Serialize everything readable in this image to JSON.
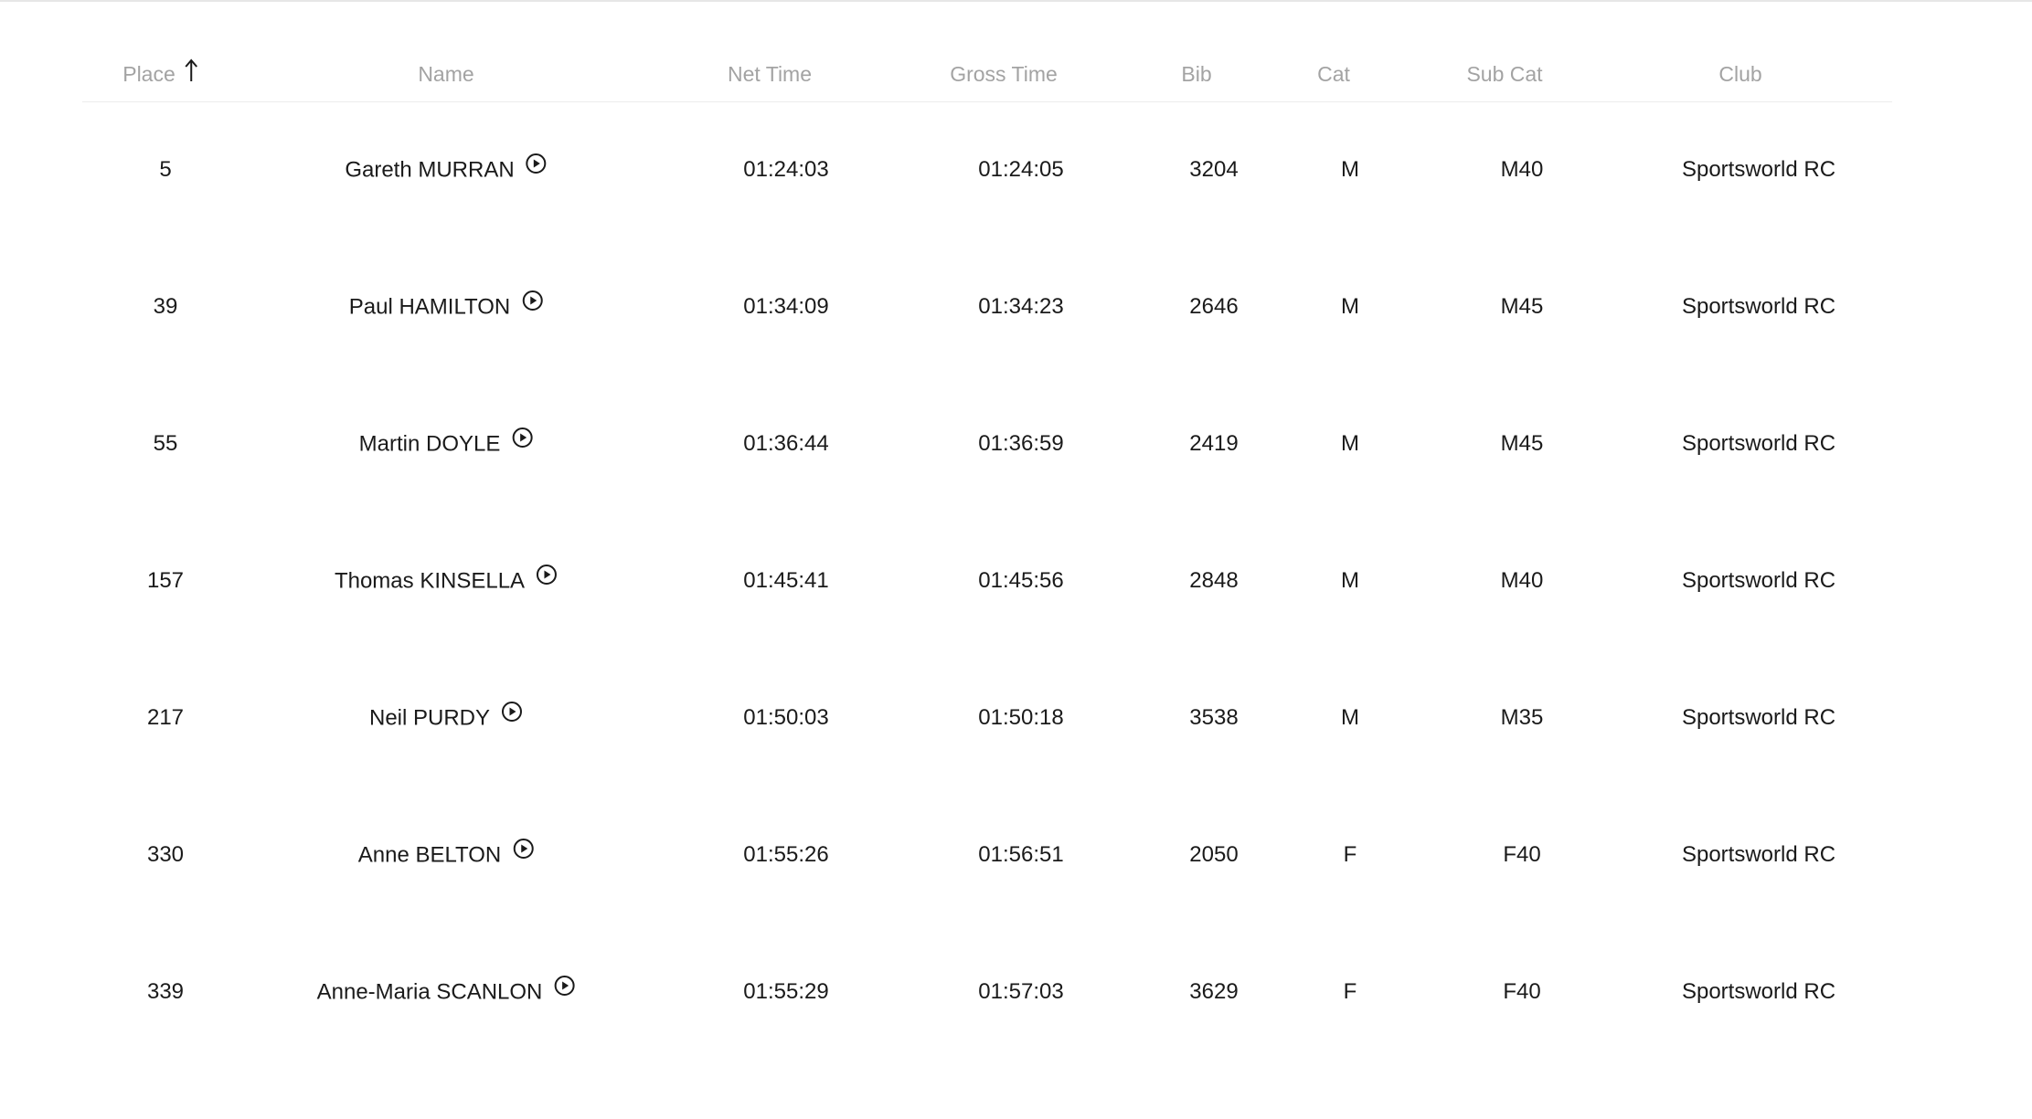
{
  "table": {
    "columns": {
      "place": "Place",
      "name": "Name",
      "net_time": "Net Time",
      "gross_time": "Gross Time",
      "bib": "Bib",
      "cat": "Cat",
      "sub_cat": "Sub Cat",
      "club": "Club"
    },
    "sort": {
      "column": "place",
      "direction": "ascending",
      "icon": "arrow-up-icon"
    },
    "rows": [
      {
        "place": "5",
        "name": "Gareth MURRAN",
        "net_time": "01:24:03",
        "gross_time": "01:24:05",
        "bib": "3204",
        "cat": "M",
        "sub_cat": "M40",
        "club": "Sportsworld RC"
      },
      {
        "place": "39",
        "name": "Paul HAMILTON",
        "net_time": "01:34:09",
        "gross_time": "01:34:23",
        "bib": "2646",
        "cat": "M",
        "sub_cat": "M45",
        "club": "Sportsworld RC"
      },
      {
        "place": "55",
        "name": "Martin DOYLE",
        "net_time": "01:36:44",
        "gross_time": "01:36:59",
        "bib": "2419",
        "cat": "M",
        "sub_cat": "M45",
        "club": "Sportsworld RC"
      },
      {
        "place": "157",
        "name": "Thomas KINSELLA",
        "net_time": "01:45:41",
        "gross_time": "01:45:56",
        "bib": "2848",
        "cat": "M",
        "sub_cat": "M40",
        "club": "Sportsworld RC"
      },
      {
        "place": "217",
        "name": "Neil PURDY",
        "net_time": "01:50:03",
        "gross_time": "01:50:18",
        "bib": "3538",
        "cat": "M",
        "sub_cat": "M35",
        "club": "Sportsworld RC"
      },
      {
        "place": "330",
        "name": "Anne BELTON",
        "net_time": "01:55:26",
        "gross_time": "01:56:51",
        "bib": "2050",
        "cat": "F",
        "sub_cat": "F40",
        "club": "Sportsworld RC"
      },
      {
        "place": "339",
        "name": "Anne-Maria SCANLON",
        "net_time": "01:55:29",
        "gross_time": "01:57:03",
        "bib": "3629",
        "cat": "F",
        "sub_cat": "F40",
        "club": "Sportsworld RC"
      }
    ],
    "row_icon": "play-circle-icon"
  }
}
